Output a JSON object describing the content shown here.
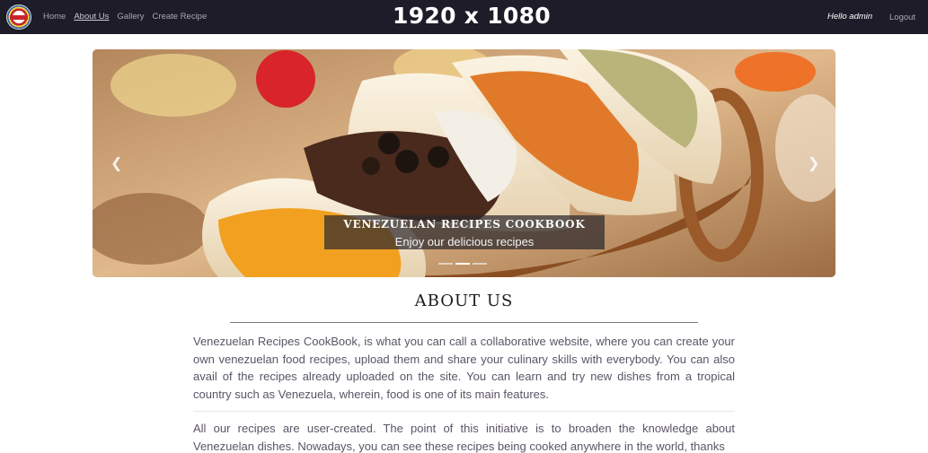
{
  "nav": {
    "links": [
      "Home",
      "About Us",
      "Gallery",
      "Create Recipe"
    ],
    "greeting": "Hello admin",
    "logout": "Logout"
  },
  "overlay_label": "1920 x 1080",
  "carousel": {
    "caption_title": "VENEZUELAN RECIPES COOKBOOK",
    "caption_subtitle": "Enjoy our delicious recipes",
    "prev_icon": "chevron-left-icon",
    "next_icon": "chevron-right-icon",
    "slide_count": 3,
    "active_slide": 2
  },
  "about": {
    "title": "ABOUT US",
    "paragraph1": "Venezuelan Recipes CookBook, is what you can call a collaborative website, where you can create your own venezuelan food recipes, upload them and share your culinary skills with everybody. You can also avail of the recipes already uploaded on the site. You can learn and try new dishes from a tropical country such as Venezuela, wherein, food is one of its main features.",
    "paragraph2": "All our recipes are user-created. The point of this initiative is to broaden the knowledge about Venezuelan dishes. Nowadays, you can see these recipes being cooked anywhere in the world, thanks"
  },
  "colors": {
    "navbar": "#1f1c29",
    "text": "#5b5466",
    "caption_bg": "#2d282d"
  }
}
